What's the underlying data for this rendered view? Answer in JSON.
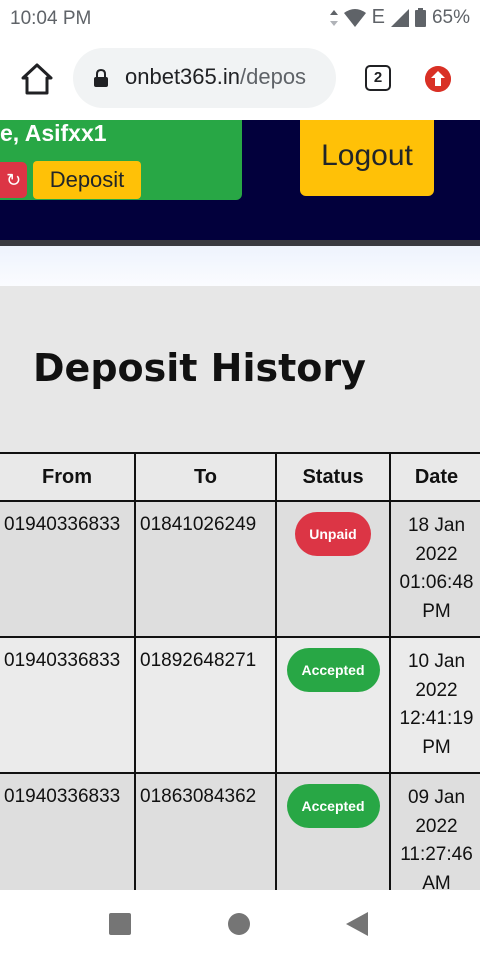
{
  "statusbar": {
    "time": "10:04 PM",
    "network": "E",
    "battery": "65%"
  },
  "browser": {
    "url_host": "onbet365.in",
    "url_path": "/depos",
    "tab_count": "2"
  },
  "header": {
    "username": "e, Asifxx1",
    "deposit_label": "Deposit",
    "logout_label": "Logout"
  },
  "page": {
    "title": "Deposit History"
  },
  "table": {
    "headers": [
      "From",
      "To",
      "Status",
      "Date"
    ],
    "rows": [
      {
        "from": "01940336833",
        "to": "01841026249",
        "status": "Unpaid",
        "date_day": "18 Jan",
        "date_year": "2022",
        "date_time": "01:06:48",
        "date_ampm": "PM"
      },
      {
        "from": "01940336833",
        "to": "01892648271",
        "status": "Accepted",
        "date_day": "10 Jan",
        "date_year": "2022",
        "date_time": "12:41:19",
        "date_ampm": "PM"
      },
      {
        "from": "01940336833",
        "to": "01863084362",
        "status": "Accepted",
        "date_day": "09 Jan",
        "date_year": "2022",
        "date_time": "11:27:46",
        "date_ampm": "AM"
      }
    ]
  },
  "colors": {
    "header_bg": "#02003c",
    "user_panel": "#28a745",
    "yellow": "#ffc107",
    "unpaid": "#dc3545",
    "accepted": "#28a745"
  }
}
